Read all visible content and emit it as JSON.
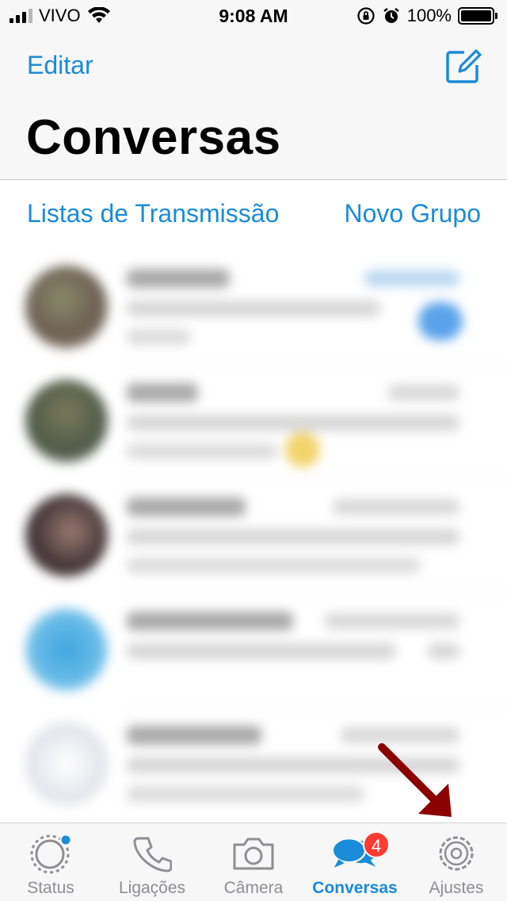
{
  "status_bar": {
    "carrier": "VIVO",
    "time": "9:08 AM",
    "battery": "100%",
    "battery_level": 1.0,
    "icons": [
      "signal-icon",
      "wifi-icon",
      "rotation-lock-icon",
      "alarm-icon",
      "battery-icon"
    ]
  },
  "header": {
    "edit_label": "Editar",
    "compose_icon": "compose-icon",
    "title": "Conversas"
  },
  "links": {
    "broadcast_lists": "Listas de Transmissão",
    "new_group": "Novo Grupo"
  },
  "tabs": [
    {
      "label": "Status",
      "icon": "status-icon",
      "active": false
    },
    {
      "label": "Ligações",
      "icon": "phone-icon",
      "active": false
    },
    {
      "label": "Câmera",
      "icon": "camera-icon",
      "active": false
    },
    {
      "label": "Conversas",
      "icon": "chats-icon",
      "active": true,
      "badge": "4"
    },
    {
      "label": "Ajustes",
      "icon": "settings-icon",
      "active": false
    }
  ],
  "colors": {
    "accent": "#1a8bd8",
    "badge": "#fe3b30",
    "annotation_arrow": "#8b0000"
  }
}
